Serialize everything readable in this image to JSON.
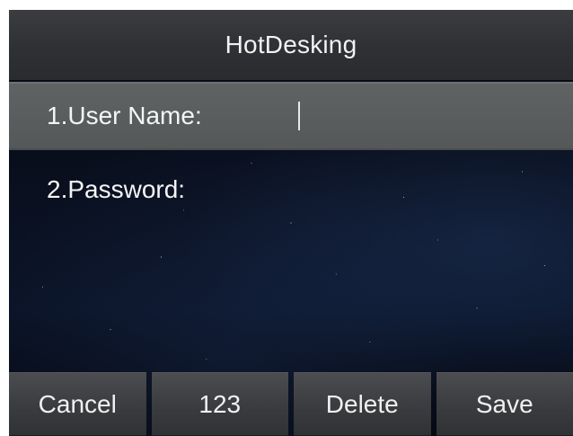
{
  "header": {
    "title": "HotDesking"
  },
  "form": {
    "fields": [
      {
        "label": "1.User Name:",
        "value": ""
      },
      {
        "label": "2.Password:",
        "value": ""
      }
    ],
    "selected_index": 0
  },
  "softkeys": [
    "Cancel",
    "123",
    "Delete",
    "Save"
  ],
  "icons": {
    "text_caret": "caret-icon"
  }
}
